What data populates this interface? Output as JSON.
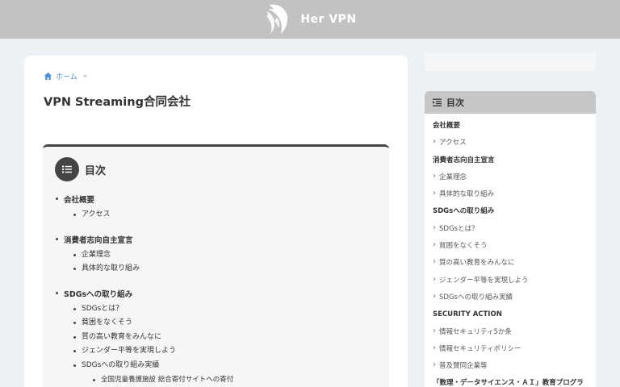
{
  "header": {
    "site_title": "Her VPN",
    "logo_icon": "woman-hair-silhouette-icon"
  },
  "breadcrumb": {
    "home_label": "ホーム",
    "home_icon": "home-icon",
    "separator": "»"
  },
  "page_title": "VPN Streaming合同会社",
  "toc": {
    "title": "目次",
    "icon": "list-icon",
    "sections": [
      {
        "label": "会社概要",
        "items": [
          {
            "label": "アクセス",
            "children": []
          }
        ]
      },
      {
        "label": "消費者志向自主宣言",
        "items": [
          {
            "label": "企業理念",
            "children": []
          },
          {
            "label": "具体的な取り組み",
            "children": []
          }
        ]
      },
      {
        "label": "SDGsへの取り組み",
        "items": [
          {
            "label": "SDGsとは？",
            "children": []
          },
          {
            "label": "貧困をなくそう",
            "children": []
          },
          {
            "label": "質の高い教育をみんなに",
            "children": []
          },
          {
            "label": "ジェンダー平等を実現しよう",
            "children": []
          },
          {
            "label": "SDGsへの取り組み実績",
            "children": [
              "全国児童養護施設 総合寄付サイトへの寄付"
            ]
          }
        ]
      }
    ]
  },
  "sidebar_toc": {
    "title": "目次",
    "icon": "outline-list-icon",
    "entries": [
      {
        "type": "heading",
        "label": "会社概要"
      },
      {
        "type": "item",
        "label": "アクセス"
      },
      {
        "type": "heading",
        "label": "消費者志向自主宣言"
      },
      {
        "type": "item",
        "label": "企業理念"
      },
      {
        "type": "item",
        "label": "具体的な取り組み"
      },
      {
        "type": "heading",
        "label": "SDGsへの取り組み"
      },
      {
        "type": "item",
        "label": "SDGsとは？"
      },
      {
        "type": "item",
        "label": "貧困をなくそう"
      },
      {
        "type": "item",
        "label": "質の高い教育をみんなに"
      },
      {
        "type": "item",
        "label": "ジェンダー平等を実現しよう"
      },
      {
        "type": "item",
        "label": "SDGsへの取り組み実績"
      },
      {
        "type": "heading",
        "label": "SECURITY ACTION"
      },
      {
        "type": "item",
        "label": "情報セキュリティ5か条"
      },
      {
        "type": "item",
        "label": "情報セキュリティポリシー"
      },
      {
        "type": "item",
        "label": "普及賛同企業等"
      },
      {
        "type": "heading",
        "label": "「数理・データサイエンス・ＡＩ」教育プログラ"
      }
    ]
  },
  "colors": {
    "header_bg": "#c2c2c2",
    "page_bg": "#edf0f4",
    "link": "#4a8fe2",
    "toc_accent": "#444444",
    "sidebar_head_bg": "#c6c6c6"
  }
}
